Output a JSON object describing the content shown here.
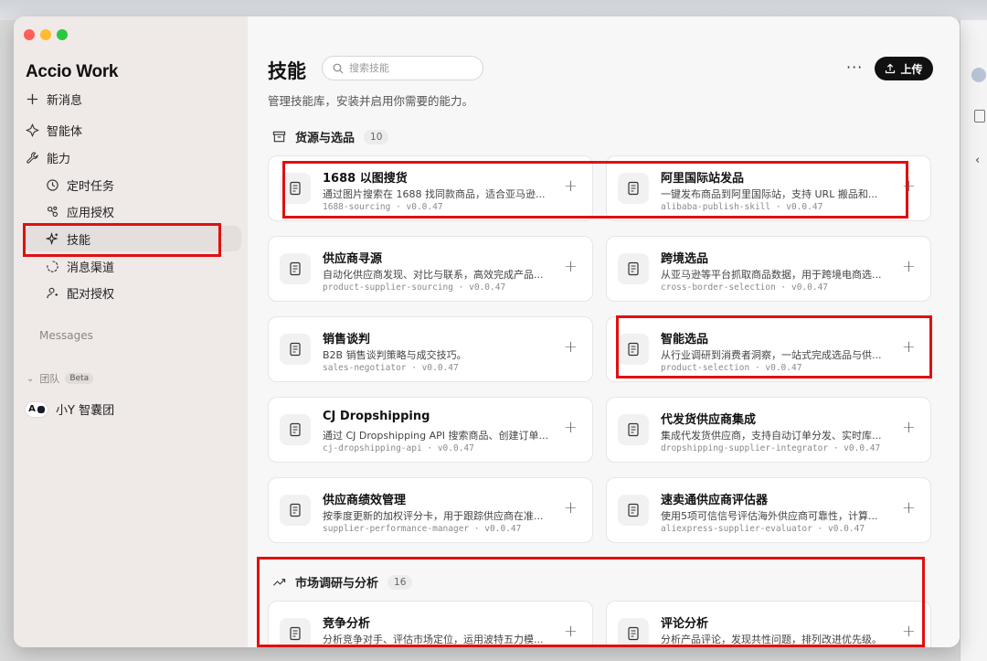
{
  "app": {
    "brand": "Accio Work"
  },
  "sidebar": {
    "new_message": "新消息",
    "agents": "智能体",
    "abilities": "能力",
    "items": [
      {
        "label": "定时任务",
        "icon": "clock-icon"
      },
      {
        "label": "应用授权",
        "icon": "link-icon"
      },
      {
        "label": "技能",
        "icon": "sparkle-icon"
      },
      {
        "label": "消息渠道",
        "icon": "channel-icon"
      },
      {
        "label": "配对授权",
        "icon": "person-key-icon"
      }
    ],
    "messages_label": "Messages",
    "team_label": "团队",
    "beta": "Beta",
    "team_item": "小Y 智囊团",
    "team_avatar_text": "A"
  },
  "header": {
    "title": "技能",
    "search_placeholder": "搜索技能",
    "more": "···",
    "upload": "上传",
    "subtitle": "管理技能库，安装并启用你需要的能力。"
  },
  "sections": [
    {
      "title": "货源与选品",
      "count": "10",
      "icon": "archive-box-icon",
      "cards": [
        {
          "title": "1688 以图搜货",
          "desc": "通过图片搜索在 1688 找同款商品，适合亚马逊...",
          "meta": "1688-sourcing · v0.0.47"
        },
        {
          "title": "阿里国际站发品",
          "desc": "一键发布商品到阿里国际站，支持 URL 搬品和...",
          "meta": "alibaba-publish-skill · v0.0.47"
        },
        {
          "title": "供应商寻源",
          "desc": "自动化供应商发现、对比与联系，高效完成产品...",
          "meta": "product-supplier-sourcing · v0.0.47"
        },
        {
          "title": "跨境选品",
          "desc": "从亚马逊等平台抓取商品数据，用于跨境电商选...",
          "meta": "cross-border-selection · v0.0.47"
        },
        {
          "title": "销售谈判",
          "desc": "B2B 销售谈判策略与成交技巧。",
          "meta": "sales-negotiator · v0.0.47"
        },
        {
          "title": "智能选品",
          "desc": "从行业调研到消费者洞察，一站式完成选品与供...",
          "meta": "product-selection · v0.0.47"
        },
        {
          "title": "CJ Dropshipping",
          "desc": "通过 CJ Dropshipping API 搜索商品、创建订单...",
          "meta": "cj-dropshipping-api · v0.0.47"
        },
        {
          "title": "代发货供应商集成",
          "desc": "集成代发货供应商，支持自动订单分发、实时库...",
          "meta": "dropshipping-supplier-integrator · v0.0.47"
        },
        {
          "title": "供应商绩效管理",
          "desc": "按季度更新的加权评分卡，用于跟踪供应商在准...",
          "meta": "supplier-performance-manager · v0.0.47"
        },
        {
          "title": "速卖通供应商评估器",
          "desc": "使用5项可信信号评估海外供应商可靠性，计算...",
          "meta": "aliexpress-supplier-evaluator · v0.0.47"
        }
      ]
    },
    {
      "title": "市场调研与分析",
      "count": "16",
      "icon": "trend-line-icon",
      "cards": [
        {
          "title": "竞争分析",
          "desc": "分析竞争对手、评估市场定位，运用波特五力模...",
          "meta": ""
        },
        {
          "title": "评论分析",
          "desc": "分析产品评论，发现共性问题，排列改进优先级。",
          "meta": ""
        }
      ]
    }
  ],
  "colors": {
    "accent": "#111111",
    "annotation": "#e01010",
    "sidebar_bg": "#efe9e7",
    "main_bg": "#f7f7f7"
  }
}
